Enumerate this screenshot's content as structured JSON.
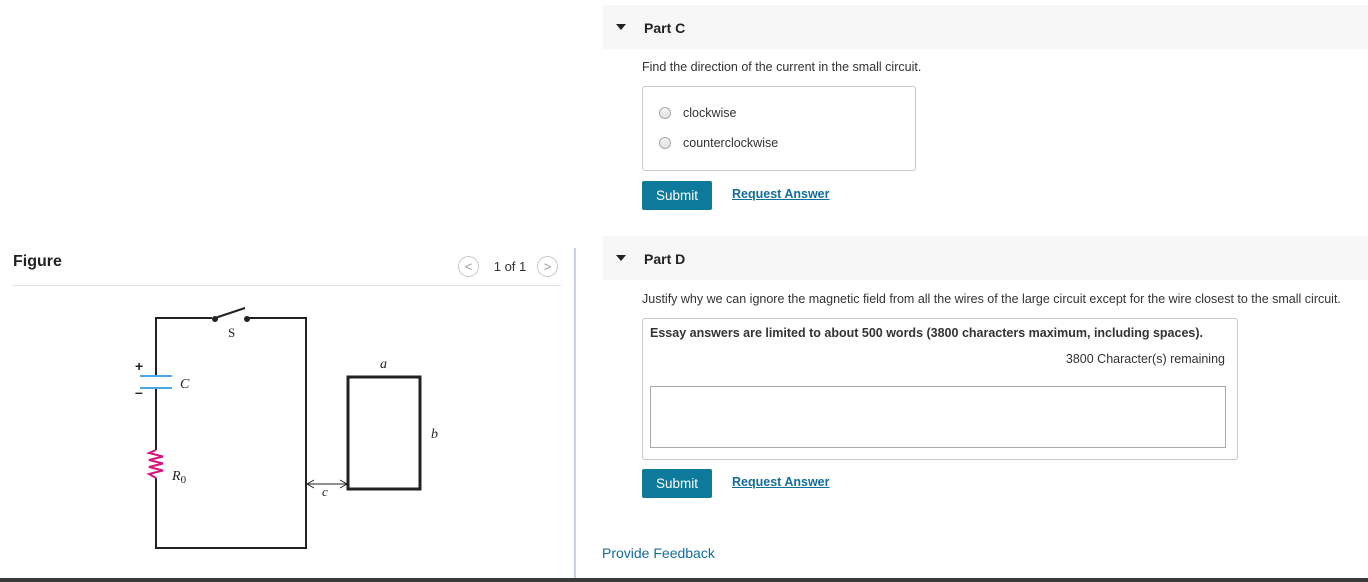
{
  "figure": {
    "title": "Figure",
    "counter": "1 of 1",
    "prev_glyph": "<",
    "next_glyph": ">",
    "labels": {
      "switch": "S",
      "capacitor": "C",
      "resistor": "R",
      "resistor_sub": "0",
      "plus": "+",
      "minus": "–",
      "a": "a",
      "b": "b",
      "c": "c"
    },
    "colors": {
      "capacitor": "#4aa7e6",
      "resistor": "#d6147a",
      "wire": "#222222"
    }
  },
  "part_c": {
    "title": "Part C",
    "question": "Find the direction of the current in the small circuit.",
    "options": [
      "clockwise",
      "counterclockwise"
    ],
    "submit_label": "Submit",
    "request_label": "Request Answer"
  },
  "part_d": {
    "title": "Part D",
    "question": "Justify why we can ignore the magnetic field from all the wires of the large circuit except for the wire closest to the small circuit.",
    "essay_limit": "Essay answers are limited to about 500 words (3800 characters maximum, including spaces).",
    "chars_remaining": "3800 Character(s) remaining",
    "essay_value": "",
    "submit_label": "Submit",
    "request_label": "Request Answer"
  },
  "feedback_label": "Provide Feedback",
  "colors": {
    "accent": "#0d7a9c",
    "link": "#136d9a"
  }
}
